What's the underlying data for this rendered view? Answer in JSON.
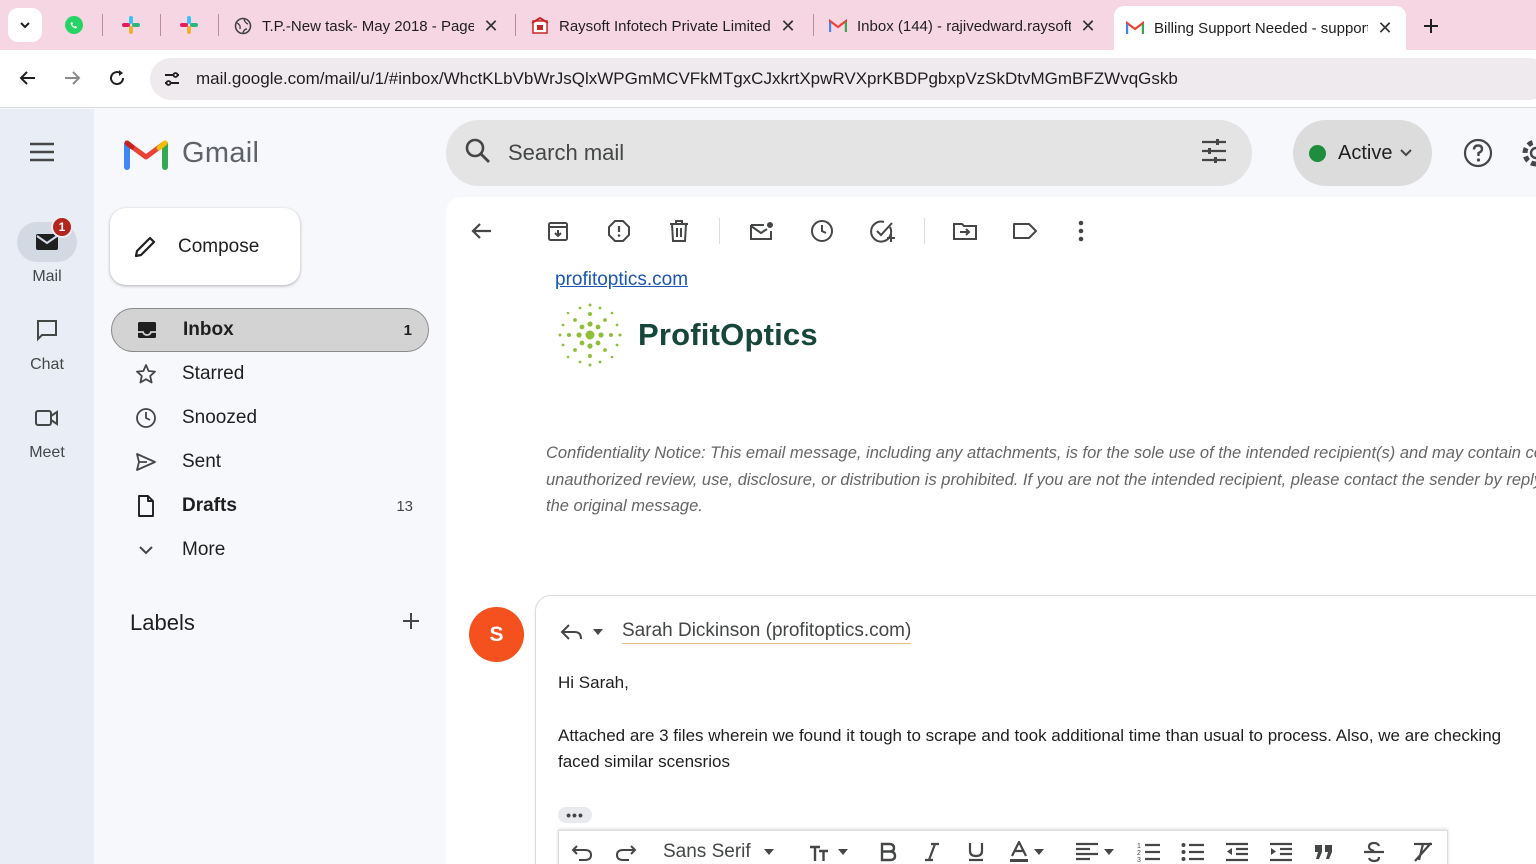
{
  "browser": {
    "tabs": [
      {
        "title": "T.P.-New task- May 2018 - Page",
        "icon": "globe-icon"
      },
      {
        "title": "Raysoft Infotech Private Limited",
        "icon": "raysoft-icon"
      },
      {
        "title": "Inbox (144) - rajivedward.raysoft",
        "icon": "gmail-icon"
      },
      {
        "title": "Billing Support Needed - support",
        "icon": "gmail-icon",
        "active": true
      }
    ],
    "url": "mail.google.com/mail/u/1/#inbox/WhctKLbVbWrJsQlxWPGmMCVFkMTgxCJxkrtXpwRVXprKBDPgbxpVzSkDtvMGmBFZWvqGskb"
  },
  "rail": {
    "mail_label": "Mail",
    "mail_badge": "1",
    "chat_label": "Chat",
    "meet_label": "Meet"
  },
  "gmail": {
    "logo_text": "Gmail",
    "compose_label": "Compose",
    "search_placeholder": "Search mail",
    "status": "Active",
    "status_color": "#1e8e3e"
  },
  "nav": {
    "items": [
      {
        "label": "Inbox",
        "count": "1"
      },
      {
        "label": "Starred",
        "count": ""
      },
      {
        "label": "Snoozed",
        "count": ""
      },
      {
        "label": "Sent",
        "count": ""
      },
      {
        "label": "Drafts",
        "count": "13"
      },
      {
        "label": "More",
        "count": ""
      }
    ],
    "labels_heading": "Labels"
  },
  "message": {
    "signature_link": "profitoptics.com",
    "brand_name": "ProfitOptics",
    "notice_lines": [
      "Confidentiality Notice: This email message, including any attachments, is for the sole use of the intended recipient(s) and may contain confidential",
      "unauthorized review, use, disclosure, or distribution is prohibited. If you are not the intended recipient, please contact the sender by reply email",
      "the original message."
    ]
  },
  "reply": {
    "avatar_letter": "S",
    "to": "Sarah Dickinson (profitoptics.com)",
    "greeting": "Hi Sarah,",
    "body_line1": "Attached are 3 files wherein we found it tough to scrape and took additional time than usual to process. Also, we are checking",
    "body_line2": "faced similar scensrios",
    "font_label": "Sans Serif"
  }
}
